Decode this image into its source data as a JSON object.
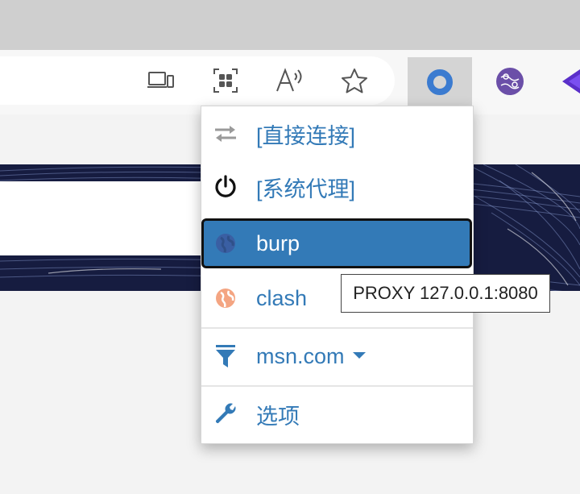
{
  "toolbar": {
    "icons": [
      "devices-icon",
      "apps-grid-icon",
      "read-aloud-icon",
      "favorite-star-icon",
      "switchyomega-extension-icon",
      "travel-map-extension-icon",
      "purple-extension-icon"
    ]
  },
  "popup": {
    "items": [
      {
        "label": "[直接连接]",
        "icon": "swap-arrows-icon"
      },
      {
        "label": "[系统代理]",
        "icon": "power-icon"
      },
      {
        "label": "burp",
        "icon": "globe-icon",
        "selected": true
      },
      {
        "label": "clash",
        "icon": "globe-icon"
      },
      {
        "label": "msn.com",
        "icon": "filter-icon"
      },
      {
        "label": "选项",
        "icon": "wrench-icon"
      }
    ]
  },
  "tooltip": {
    "text": "PROXY 127.0.0.1:8080"
  },
  "colors": {
    "accent": "#337ab7",
    "clash_icon": "#f4a582",
    "burp_icon": "#3a5fa3"
  }
}
